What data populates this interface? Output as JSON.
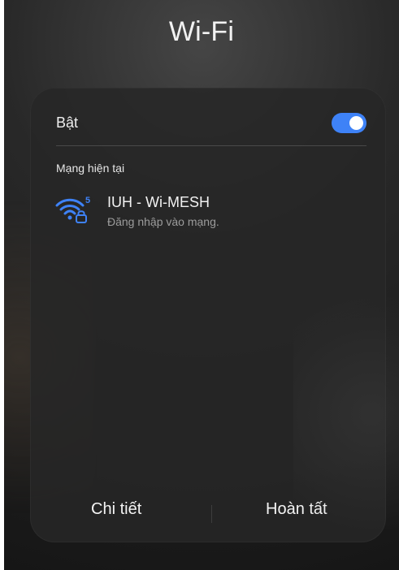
{
  "header": {
    "title": "Wi-Fi"
  },
  "wifi": {
    "enabled_label": "Bật",
    "toggle_on": true,
    "current_network_section": "Mạng hiện tại",
    "current_network": {
      "name": "IUH - Wi-MESH",
      "status": "Đăng nhập vào mạng.",
      "band": "5",
      "icon": "wifi-lock-icon"
    }
  },
  "footer": {
    "details_label": "Chi tiết",
    "done_label": "Hoàn tất"
  },
  "colors": {
    "accent": "#3E82F7",
    "background": "#1E1E1E",
    "panel": "#262626",
    "text_primary": "#F2F2F2",
    "text_secondary": "#9C9C9C"
  }
}
